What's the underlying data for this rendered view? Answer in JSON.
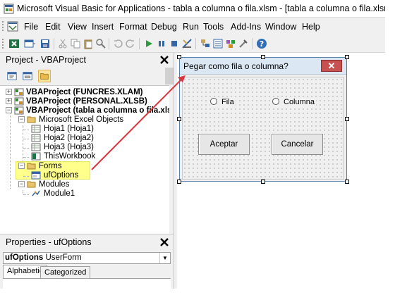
{
  "window": {
    "title": "Microsoft Visual Basic for Applications - tabla a columna o fila.xlsm - [tabla a columna o fila.xlsm - ufOptions (UserForm)]"
  },
  "menu": {
    "items": [
      "File",
      "Edit",
      "View",
      "Insert",
      "Format",
      "Debug",
      "Run",
      "Tools",
      "Add-Ins",
      "Window",
      "Help"
    ]
  },
  "project_panel": {
    "title": "Project - VBAProject",
    "tree": {
      "projects": [
        {
          "label": "VBAProject (FUNCRES.XLAM)"
        },
        {
          "label": "VBAProject (PERSONAL.XLSB)"
        },
        {
          "label": "VBAProject (tabla a columna o fila.xlsm)"
        }
      ],
      "excel_objects_label": "Microsoft Excel Objects",
      "sheets": [
        "Hoja1 (Hoja1)",
        "Hoja2 (Hoja2)",
        "Hoja3 (Hoja3)",
        "ThisWorkbook"
      ],
      "forms_label": "Forms",
      "form_item": "ufOptions",
      "modules_label": "Modules",
      "module_item": "Module1"
    }
  },
  "properties_panel": {
    "title": "Properties - ufOptions",
    "object_name": "ufOptions",
    "object_type": "UserForm",
    "tabs": [
      "Alphabetic",
      "Categorized"
    ]
  },
  "userform": {
    "caption": "Pegar como fila o columna?",
    "option_fila": "Fila",
    "option_columna": "Columna",
    "button_accept": "Aceptar",
    "button_cancel": "Cancelar"
  },
  "colors": {
    "highlight": "#ffff8c",
    "arrow": "#d9363e",
    "close_button": "#c75050"
  }
}
